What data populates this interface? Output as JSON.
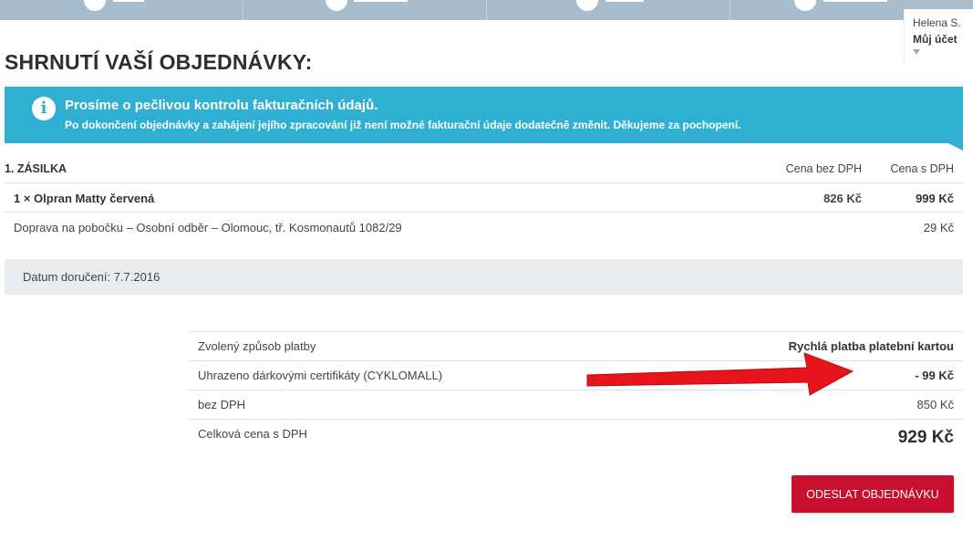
{
  "account": {
    "user_name": "Helena S.",
    "account_label": "Můj účet"
  },
  "page_title": "SHRNUTÍ VAŠÍ OBJEDNÁVKY:",
  "notice": {
    "title": "Prosíme o pečlivou kontrolu fakturačních údajů.",
    "text": "Po dokončení objednávky a zahájení jejího zpracování již není možné fakturační údaje dodatečně změnit. Děkujeme za pochopení.",
    "icon": "info-icon",
    "color": "#2fb0d3"
  },
  "shipment": {
    "title": "1. ZÁSILKA",
    "col_price_no_vat": "Cena bez DPH",
    "col_price_vat": "Cena s DPH",
    "items": [
      {
        "label": "1 × Olpran Matty červená",
        "price_no_vat": "826 Kč",
        "price_vat": "999 Kč"
      }
    ],
    "delivery": {
      "label": "Doprava na pobočku – Osobní odběr – Olomouc, tř. Kosmonautů 1082/29",
      "price_vat": "29 Kč"
    },
    "delivery_date": "Datum doručení: 7.7.2016"
  },
  "summary": {
    "payment_label": "Zvolený způsob platby",
    "payment_value": "Rychlá platba platební kartou",
    "voucher_label": "Uhrazeno dárkovými certifikáty (CYKLOMALL)",
    "voucher_value": "- 99 Kč",
    "no_vat_label": "bez DPH",
    "no_vat_value": "850 Kč",
    "total_label": "Celková cena s DPH",
    "total_value": "929 Kč"
  },
  "submit_label": "ODESLAT OBJEDNÁVKU",
  "colors": {
    "accent": "#c8102e",
    "topbar": "#a9bccb",
    "annotation_arrow": "#e8141b"
  }
}
